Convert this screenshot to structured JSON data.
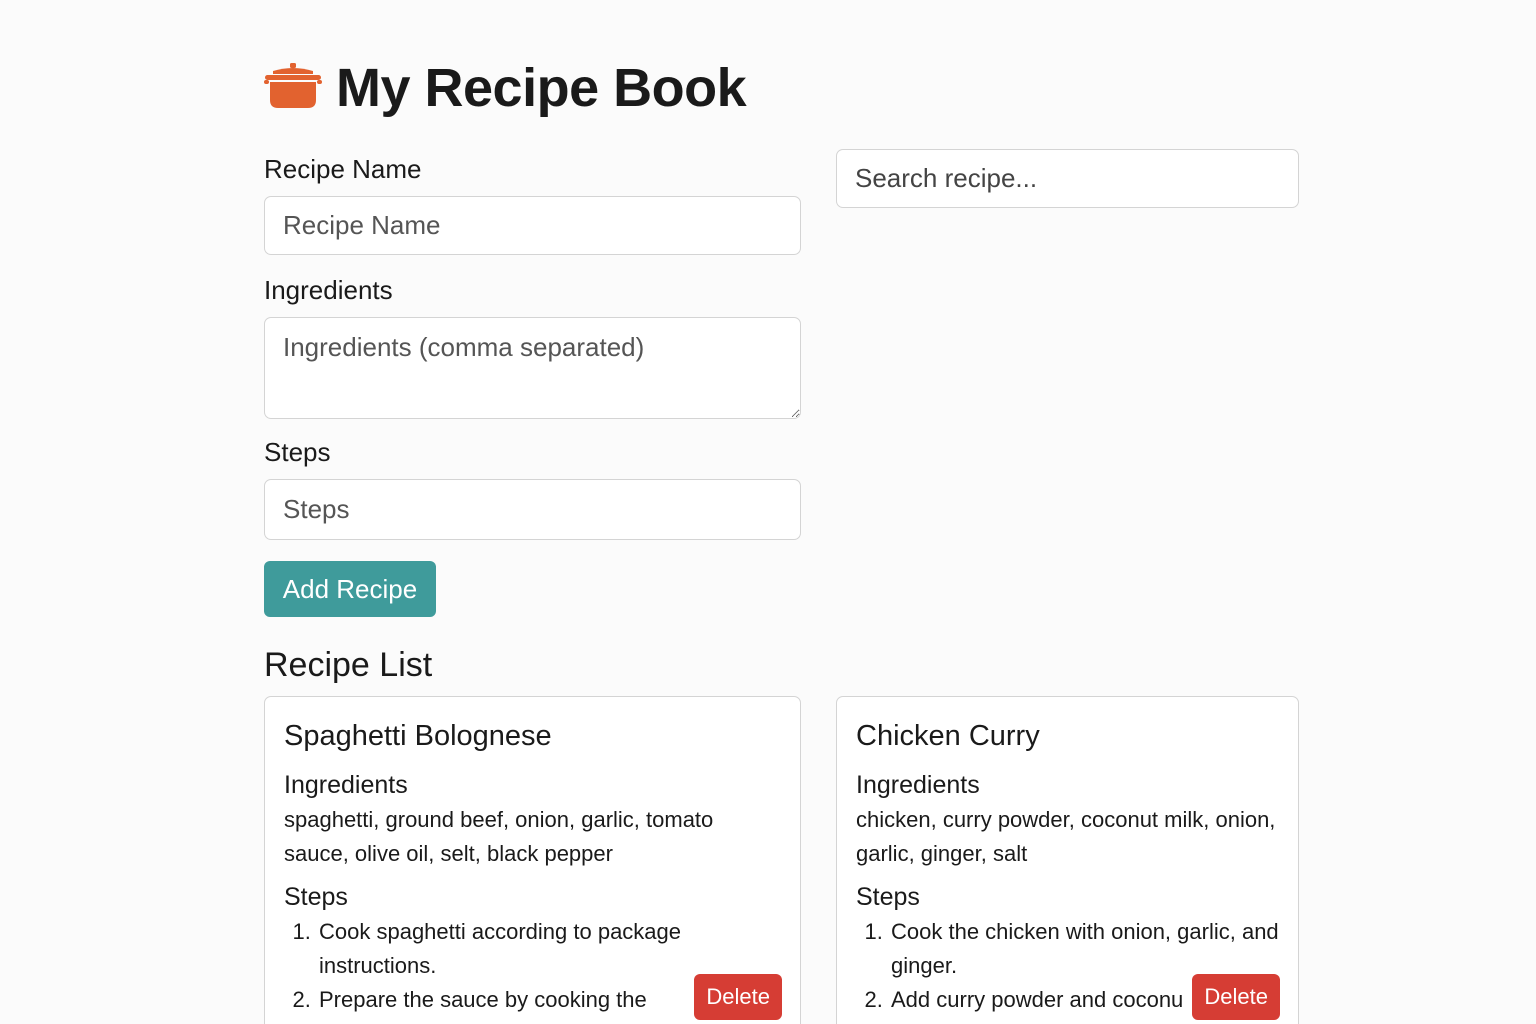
{
  "header": {
    "icon": "cooking-pot-icon",
    "title": "My Recipe Book"
  },
  "form": {
    "name_label": "Recipe Name",
    "name_placeholder": "Recipe Name",
    "ingredients_label": "Ingredients",
    "ingredients_placeholder": "Ingredients (comma separated)",
    "steps_label": "Steps",
    "steps_placeholder": "Steps",
    "add_button": "Add Recipe"
  },
  "search": {
    "placeholder": "Search recipe..."
  },
  "list": {
    "title": "Recipe List",
    "recipes": [
      {
        "name": "Spaghetti Bolognese",
        "ingredients_heading": "Ingredients",
        "ingredients": "spaghetti, ground beef, onion, garlic, tomato sauce, olive oil, selt, black pepper",
        "steps_heading": "Steps",
        "steps": [
          "Cook spaghetti according to package instructions.",
          "Prepare the sauce by cooking the"
        ],
        "delete_label": "Delete"
      },
      {
        "name": "Chicken Curry",
        "ingredients_heading": "Ingredients",
        "ingredients": "chicken, curry powder, coconut milk, onion, garlic, ginger, salt",
        "steps_heading": "Steps",
        "steps": [
          "Cook the chicken with onion, garlic, and ginger.",
          "Add curry powder and coconu"
        ],
        "delete_label": "Delete"
      }
    ]
  },
  "colors": {
    "accent": "#3f9b9b",
    "danger": "#d63d34",
    "icon": "#e2622f"
  }
}
